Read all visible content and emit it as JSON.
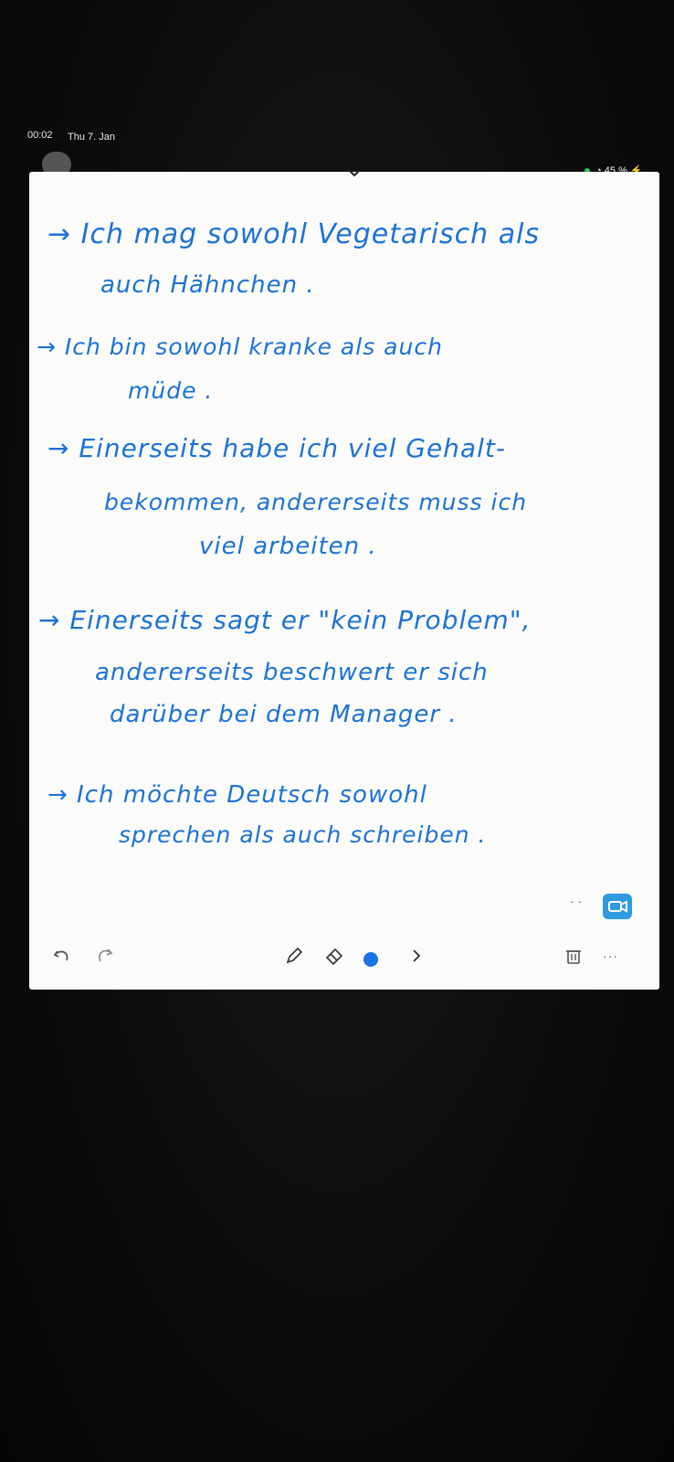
{
  "status_bar": {
    "time": "00:02",
    "date": "Thu 7. Jan",
    "battery": "45 %"
  },
  "note": {
    "lines": [
      "→ Ich mag sowohl Vegetarisch als",
      "auch Hähnchen .",
      "→ Ich bin sowohl kranke als auch",
      "müde .",
      "→ Einerseits habe ich viel Gehalt-",
      "bekommen, andererseits muss ich",
      "viel arbeiten .",
      "→ Einerseits sagt er \"kein Problem\",",
      "andererseits beschwert er sich",
      "darüber bei dem Manager .",
      "→ Ich möchte Deutsch sowohl",
      "sprechen als auch schreiben ."
    ]
  },
  "toolbar": {
    "more_label": "···",
    "pen_color": "#1773e6"
  },
  "colors": {
    "ink": "#1b72d6",
    "paper": "#fbfbf9",
    "record_button": "#2f9ae0"
  },
  "icons": [
    "chevron-down-icon",
    "undo-icon",
    "redo-icon",
    "pen-icon",
    "eraser-icon",
    "next-icon",
    "trash-icon",
    "record-icon"
  ]
}
